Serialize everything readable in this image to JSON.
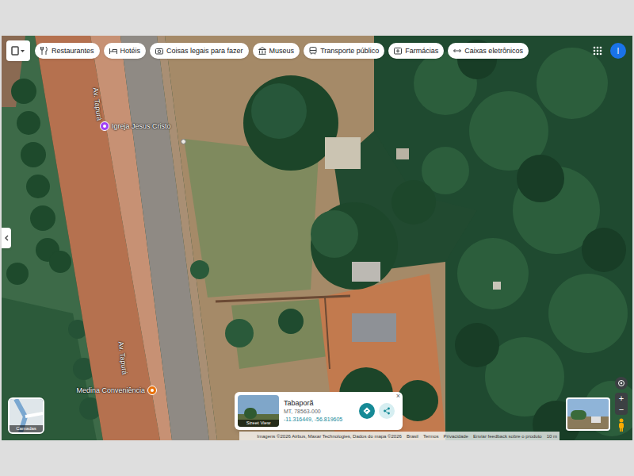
{
  "top_bar": {
    "chips": [
      {
        "label": "Restaurantes"
      },
      {
        "label": "Hotéis"
      },
      {
        "label": "Coisas legais para fazer"
      },
      {
        "label": "Museus"
      },
      {
        "label": "Transporte público"
      },
      {
        "label": "Farmácias"
      },
      {
        "label": "Caixas eletrônicos"
      }
    ]
  },
  "account": {
    "avatar_letter": "I"
  },
  "map": {
    "road_labels": [
      "Av. Tapurá",
      "Av. Tapurá"
    ],
    "places": [
      {
        "name": "Igreja Jesus Cristo",
        "color": "#a142f4"
      },
      {
        "name": "Medina Conveniência",
        "color": "#e8710a"
      }
    ]
  },
  "layers_button": {
    "label": "Camadas"
  },
  "place_card": {
    "thumbnail_label": "Street View",
    "title": "Tabaporã",
    "subtitle": "MT, 78563-000",
    "coordinates": "-11.316449, -56.819605",
    "close": "×"
  },
  "zoom": {
    "plus": "+",
    "minus": "−"
  },
  "attribution": [
    "Imagens ©2026 Airbus, Maxar Technologies, Dados do mapa ©2026",
    "Brasil",
    "Termos",
    "Privacidade",
    "Enviar feedback sobre o produto",
    "10 m"
  ]
}
